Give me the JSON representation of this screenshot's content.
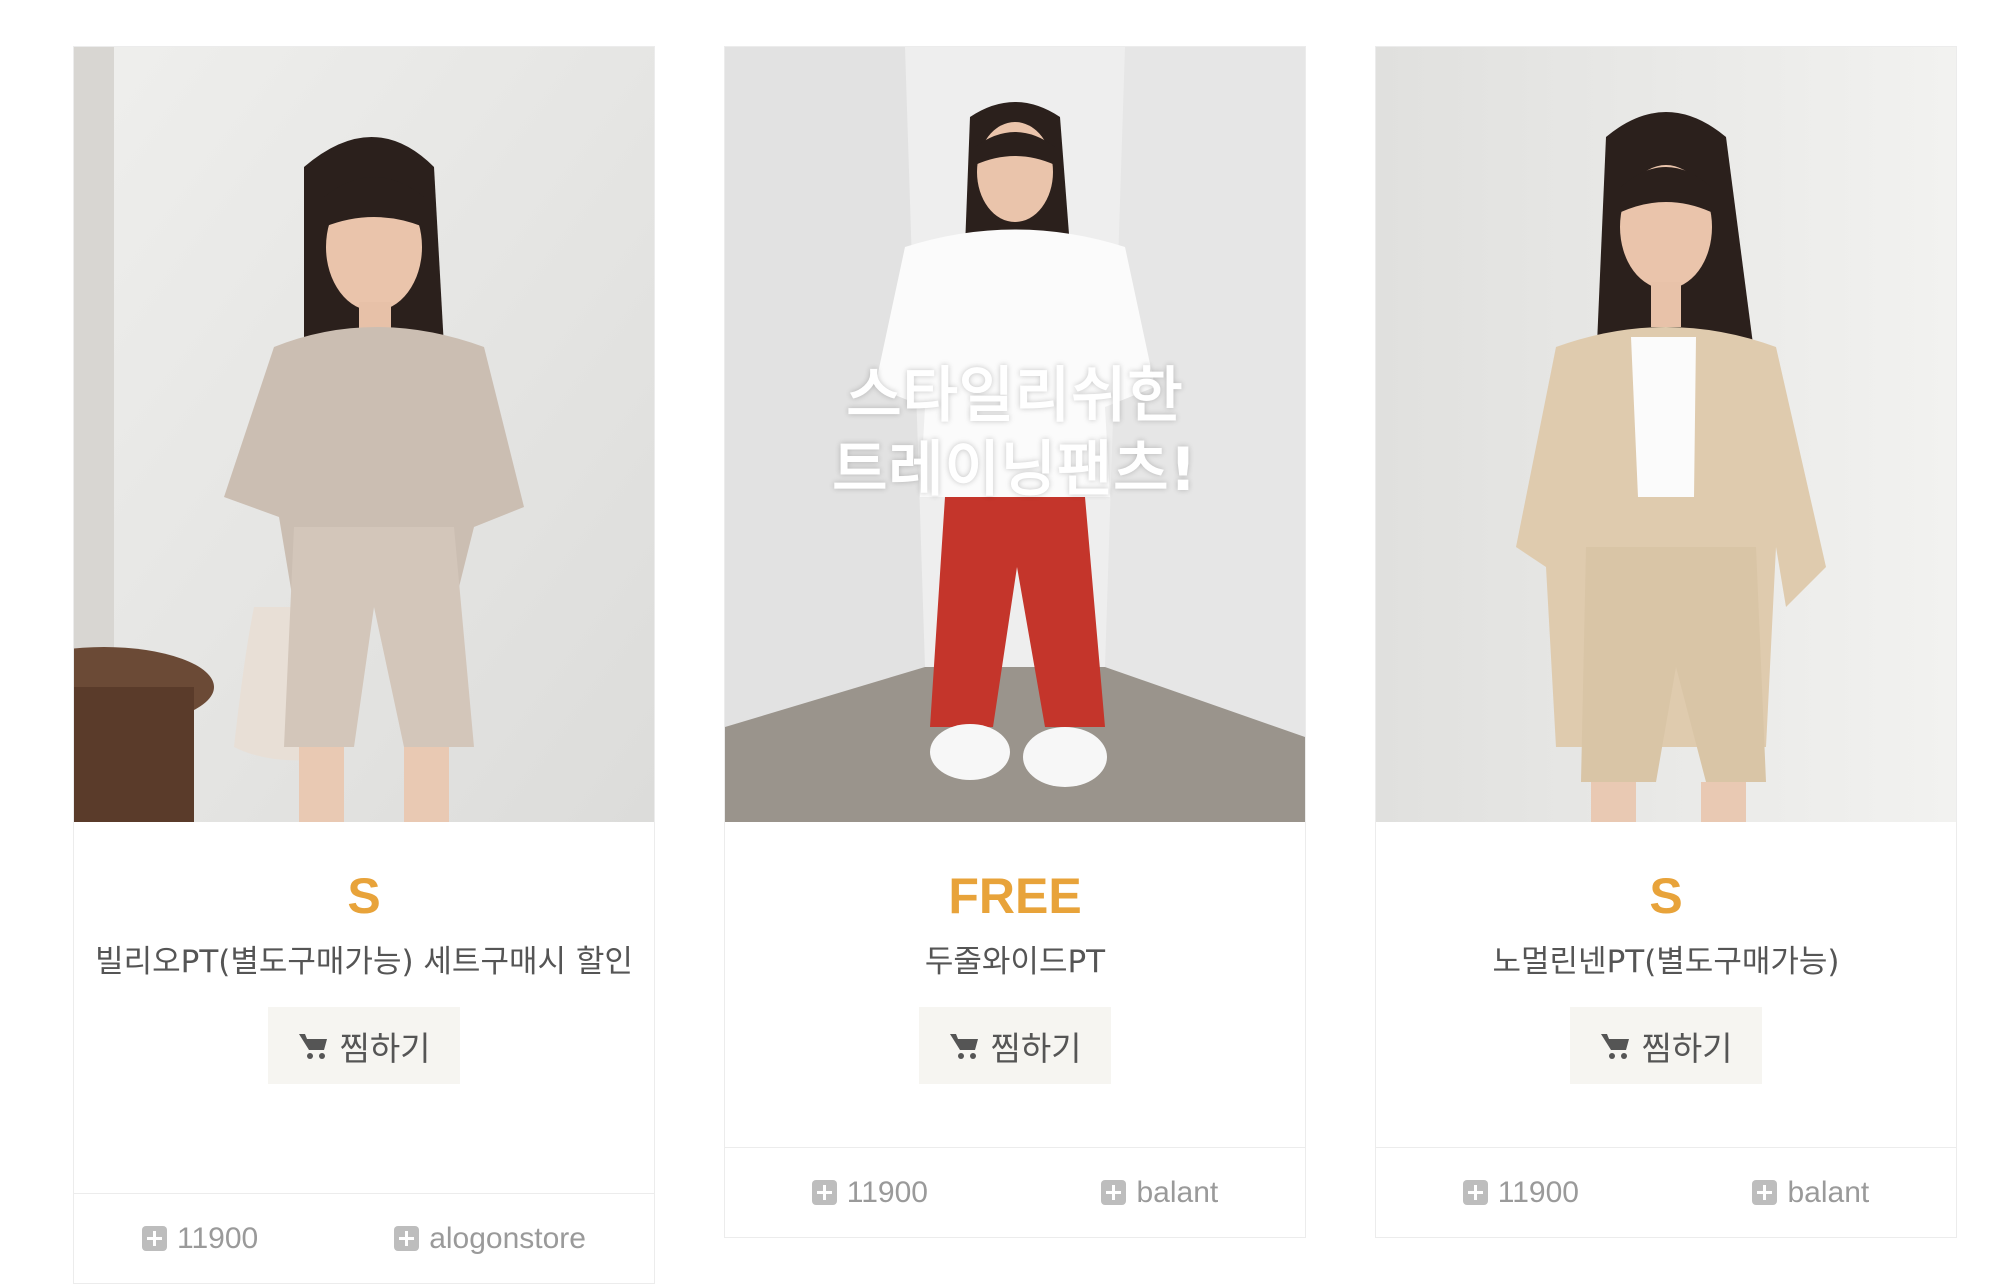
{
  "products": [
    {
      "size": "S",
      "name": "빌리오PT(별도구매가능) 세트구매시 할인",
      "wish_label": "찜하기",
      "price": "11900",
      "store": "alogonstore",
      "overlay_line1": "",
      "overlay_line2": ""
    },
    {
      "size": "FREE",
      "name": "두줄와이드PT",
      "wish_label": "찜하기",
      "price": "11900",
      "store": "balant",
      "overlay_line1": "스타일리쉬한",
      "overlay_line2": "트레이닝팬츠!"
    },
    {
      "size": "S",
      "name": "노멀린넨PT(별도구매가능)",
      "wish_label": "찜하기",
      "price": "11900",
      "store": "balant",
      "overlay_line1": "",
      "overlay_line2": ""
    }
  ],
  "colors": {
    "size_accent": "#e8a33a",
    "button_bg": "#f6f5f1",
    "meta_text": "#9a9a9a"
  },
  "icons": {
    "wish": "cart-icon",
    "meta": "plus-square-icon"
  }
}
